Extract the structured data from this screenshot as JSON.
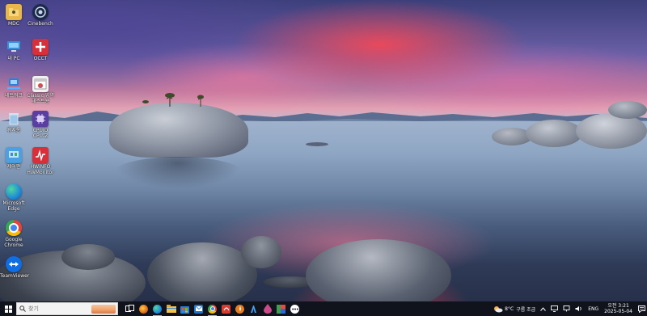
{
  "desktop": {
    "icons": [
      {
        "name": "user-folder",
        "label": "MDC",
        "glyph": "user-folder-icon",
        "color": "#e8b84a"
      },
      {
        "name": "cinebench",
        "label": "Cinebench",
        "glyph": "cinebench-icon",
        "color": "#1b2a4a"
      },
      {
        "name": "this-pc",
        "label": "내 PC",
        "glyph": "computer-icon",
        "color": "#3a8fd8"
      },
      {
        "name": "occt",
        "label": "OCCT",
        "glyph": "occt-icon",
        "color": "#d8303a"
      },
      {
        "name": "network",
        "label": "네트워크",
        "glyph": "network-icon",
        "color": "#2f7fd6"
      },
      {
        "name": "chrome-cleanup",
        "label": "Classic 영역\n테스트용",
        "glyph": "chrome-window-icon",
        "color": "#f1f1f1"
      },
      {
        "name": "recycle-bin",
        "label": "휴지통",
        "glyph": "recycle-bin-icon",
        "color": "#9ec6e8"
      },
      {
        "name": "cpu-z",
        "label": "CPUID\nCPU-Z",
        "glyph": "cpu-z-icon",
        "color": "#5b3fa0"
      },
      {
        "name": "control-panel",
        "label": "제어판",
        "glyph": "control-panel-icon",
        "color": "#4aa0e0"
      },
      {
        "name": "hwinfo",
        "label": "HWiNFO\nHWMonitor",
        "glyph": "hwmonitor-icon",
        "color": "#d8303a"
      },
      {
        "name": "edge",
        "label": "Microsoft\nEdge",
        "glyph": "edge-icon",
        "color": "#1f8bd6"
      },
      {
        "name": "google-chrome",
        "label": "Google\nChrome",
        "glyph": "chrome-icon",
        "color": "#ea4335"
      },
      {
        "name": "teamviewer",
        "label": "TeamViewer",
        "glyph": "teamviewer-icon",
        "color": "#0e6ee6"
      }
    ]
  },
  "taskbar": {
    "search_placeholder": "찾기",
    "apps": [
      {
        "name": "task-view",
        "glyph": "task-view-icon",
        "color": "#10131c",
        "text": ""
      },
      {
        "name": "widgets",
        "glyph": "widgets-icon",
        "color": "#e06a1a",
        "text": ""
      },
      {
        "name": "edge",
        "glyph": "edge-icon",
        "color": "#1f8bd6",
        "text": ""
      },
      {
        "name": "file-explorer",
        "glyph": "folder-icon",
        "color": "#f2c14e",
        "text": ""
      },
      {
        "name": "microsoft-store",
        "glyph": "store-icon",
        "color": "#2a7de1",
        "text": ""
      },
      {
        "name": "outlook",
        "glyph": "mail-icon",
        "color": "#1d74c8",
        "text": ""
      },
      {
        "name": "chrome",
        "glyph": "chrome-icon",
        "color": "#ea4335",
        "text": ""
      },
      {
        "name": "app-red",
        "glyph": "red-app-icon",
        "color": "#d63c2f",
        "text": ""
      },
      {
        "name": "safari",
        "glyph": "compass-icon",
        "color": "#e57d24",
        "text": ""
      },
      {
        "name": "app-blue",
        "glyph": "blue-app-icon",
        "color": "#3a7cc9",
        "text": ""
      },
      {
        "name": "app-drop",
        "glyph": "drop-icon",
        "color": "#c94b8a",
        "text": ""
      },
      {
        "name": "app-multicolor",
        "glyph": "multicolor-icon",
        "color": "#3f9d50",
        "text": ""
      },
      {
        "name": "app-dots",
        "glyph": "dots-icon",
        "color": "#ffffff",
        "text": ""
      }
    ],
    "weather": {
      "temp": "8°C",
      "desc": "구름 조금"
    },
    "language": "ENG",
    "clock": {
      "time": "오전 3:21",
      "date": "2025-05-04"
    }
  }
}
